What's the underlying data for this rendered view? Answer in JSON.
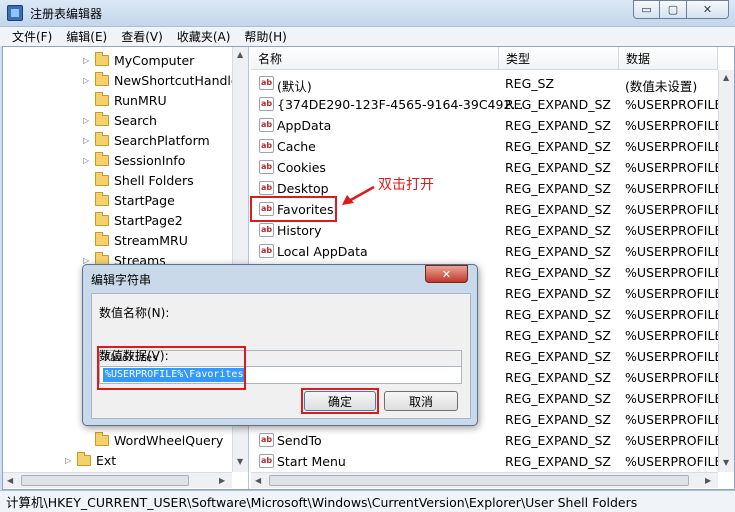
{
  "window": {
    "title": "注册表编辑器",
    "min_glyph": "▭",
    "max_glyph": "▢",
    "close_glyph": "✕"
  },
  "menu": [
    "文件(F)",
    "编辑(E)",
    "查看(V)",
    "收藏夹(A)",
    "帮助(H)"
  ],
  "tree": {
    "items": [
      "MyComputer",
      "NewShortcutHandle",
      "RunMRU",
      "Search",
      "SearchPlatform",
      "SessionInfo",
      "Shell Folders",
      "StartPage",
      "StartPage2",
      "StreamMRU",
      "Streams",
      "WordWheelQuery",
      "Ext"
    ]
  },
  "values": {
    "columns": [
      "名称",
      "类型",
      "数据"
    ],
    "rows": [
      {
        "name": "(默认)",
        "type": "REG_SZ",
        "data": "(数值未设置)"
      },
      {
        "name": "{374DE290-123F-4565-9164-39C492...",
        "type": "REG_EXPAND_SZ",
        "data": "%USERPROFILE%"
      },
      {
        "name": "AppData",
        "type": "REG_EXPAND_SZ",
        "data": "%USERPROFILE%"
      },
      {
        "name": "Cache",
        "type": "REG_EXPAND_SZ",
        "data": "%USERPROFILE%"
      },
      {
        "name": "Cookies",
        "type": "REG_EXPAND_SZ",
        "data": "%USERPROFILE%"
      },
      {
        "name": "Desktop",
        "type": "REG_EXPAND_SZ",
        "data": "%USERPROFILE%"
      },
      {
        "name": "Favorites",
        "type": "REG_EXPAND_SZ",
        "data": "%USERPROFILE%"
      },
      {
        "name": "History",
        "type": "REG_EXPAND_SZ",
        "data": "%USERPROFILE%"
      },
      {
        "name": "Local AppData",
        "type": "REG_EXPAND_SZ",
        "data": "%USERPROFILE%"
      },
      {
        "name": "",
        "type": "REG_EXPAND_SZ",
        "data": "%USERPROFILE%"
      },
      {
        "name": "",
        "type": "REG_EXPAND_SZ",
        "data": "%USERPROFILE%"
      },
      {
        "name": "",
        "type": "REG_EXPAND_SZ",
        "data": "%USERPROFILE%"
      },
      {
        "name": "",
        "type": "REG_EXPAND_SZ",
        "data": "%USERPROFILE%"
      },
      {
        "name": "",
        "type": "REG_EXPAND_SZ",
        "data": "%USERPROFILE%"
      },
      {
        "name": "",
        "type": "REG_EXPAND_SZ",
        "data": "%USERPROFILE%"
      },
      {
        "name": "",
        "type": "REG_EXPAND_SZ",
        "data": "%USERPROFILE%"
      },
      {
        "name": "",
        "type": "REG_EXPAND_SZ",
        "data": "%USERPROFILE%"
      },
      {
        "name": "SendTo",
        "type": "REG_EXPAND_SZ",
        "data": "%USERPROFILE%"
      },
      {
        "name": "Start Menu",
        "type": "REG_EXPAND_SZ",
        "data": "%USERPROFILE%"
      }
    ]
  },
  "status": "计算机\\HKEY_CURRENT_USER\\Software\\Microsoft\\Windows\\CurrentVersion\\Explorer\\User Shell Folders",
  "annotation": {
    "text": "双击打开",
    "color": "#e01a1a"
  },
  "dialog": {
    "title": "编辑字符串",
    "close_glyph": "✕",
    "name_label": "数值名称(N):",
    "name_value": "Favorites",
    "data_label": "数值数据(V):",
    "data_value": "%USERPROFILE%\\Favorites",
    "ok_label": "确定",
    "cancel_label": "取消"
  },
  "colors": {
    "highlight": "#e01a1a",
    "selection": "#3399ff",
    "window_frame": "#cfdff0"
  }
}
